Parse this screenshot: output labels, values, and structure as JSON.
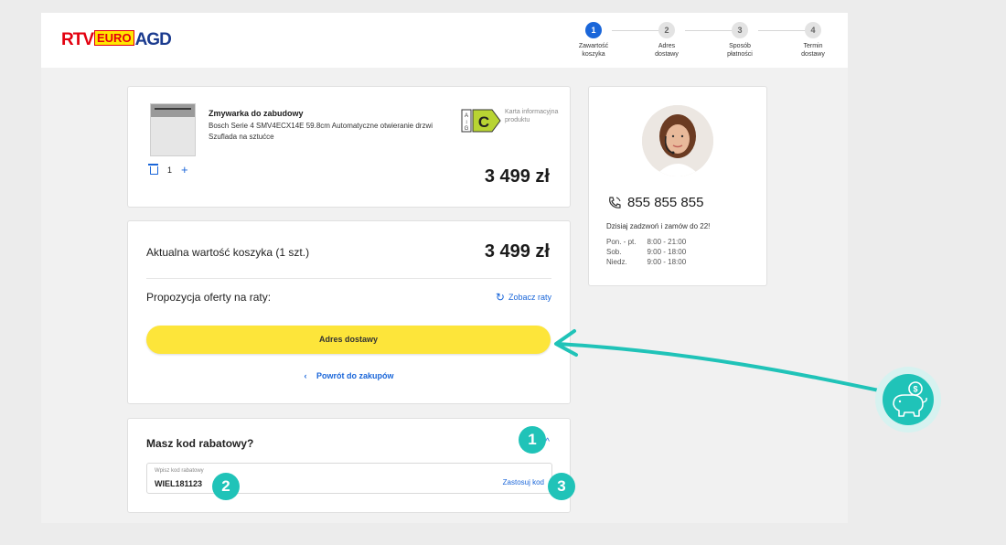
{
  "brand": {
    "logo_part1": "RTV",
    "logo_part2": "EURO",
    "logo_part3": "AGD"
  },
  "steps": [
    {
      "num": "1",
      "label": "Zawartość\nkoszyka",
      "active": true
    },
    {
      "num": "2",
      "label": "Adres\ndostawy",
      "active": false
    },
    {
      "num": "3",
      "label": "Sposób\npłatności",
      "active": false
    },
    {
      "num": "4",
      "label": "Termin\ndostawy",
      "active": false
    }
  ],
  "product": {
    "title": "Zmywarka do zabudowy",
    "description": "Bosch Serie 4 SMV4ECX14E 59.8cm Automatyczne otwieranie drzwi Szuflada na sztućce",
    "energy_class": "C",
    "energy_scale_top": "A",
    "energy_scale_bottom": "G",
    "energy_info": "Karta informacyjna produktu",
    "quantity": "1",
    "price": "3 499 zł"
  },
  "summary": {
    "label": "Aktualna wartość koszyka (1 szt.)",
    "total": "3 499 zł",
    "installments_label": "Propozycja oferty na raty:",
    "installments_link": "Zobacz raty",
    "cta": "Adres dostawy",
    "back": "Powrót do zakupów"
  },
  "discount": {
    "title": "Masz kod rabatowy?",
    "input_label": "Wpisz kod rabatowy",
    "input_value": "WIEL181123",
    "apply": "Zastosuj kod"
  },
  "contact": {
    "phone": "855 855 855",
    "call_text": "Dzisiaj zadzwoń i zamów do 22!",
    "hours": [
      {
        "days": "Pon. - pt.",
        "time": "8:00 - 21:00"
      },
      {
        "days": "Sob.",
        "time": "9:00 - 18:00"
      },
      {
        "days": "Niedz.",
        "time": "9:00 - 18:00"
      }
    ]
  },
  "annotations": {
    "b1": "1",
    "b2": "2",
    "b3": "3"
  },
  "colors": {
    "accent": "#1a66d9",
    "cta": "#fde53a",
    "teal": "#20c3b8"
  }
}
